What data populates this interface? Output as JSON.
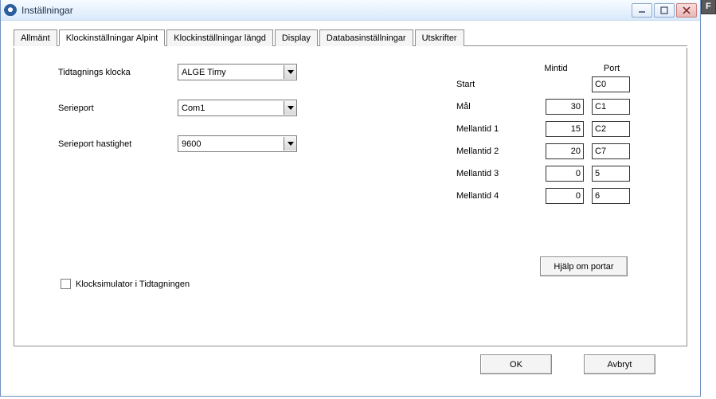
{
  "window": {
    "title": "Inställningar"
  },
  "tabs": {
    "items": [
      {
        "label": "Allmänt"
      },
      {
        "label": "Klockinställningar Alpint"
      },
      {
        "label": "Klockinställningar längd"
      },
      {
        "label": "Display"
      },
      {
        "label": "Databasinställningar"
      },
      {
        "label": "Utskrifter"
      }
    ]
  },
  "form": {
    "clock_label": "Tidtagnings klocka",
    "clock_value": "ALGE Timy",
    "serial_label": "Serieport",
    "serial_value": "Com1",
    "baud_label": "Serieport hastighet",
    "baud_value": "9600",
    "simulator_label": "Klocksimulator i Tidtagningen"
  },
  "grid": {
    "header_mintid": "Mintid",
    "header_port": "Port",
    "rows": [
      {
        "label": "Start",
        "mintid": "",
        "port": "C0"
      },
      {
        "label": "Mål",
        "mintid": "30",
        "port": "C1"
      },
      {
        "label": "Mellantid 1",
        "mintid": "15",
        "port": "C2"
      },
      {
        "label": "Mellantid 2",
        "mintid": "20",
        "port": "C7"
      },
      {
        "label": "Mellantid 3",
        "mintid": "0",
        "port": "5"
      },
      {
        "label": "Mellantid 4",
        "mintid": "0",
        "port": "6"
      }
    ],
    "help_label": "Hjälp om portar"
  },
  "buttons": {
    "ok": "OK",
    "cancel": "Avbryt"
  },
  "ext": {
    "label": "F"
  }
}
